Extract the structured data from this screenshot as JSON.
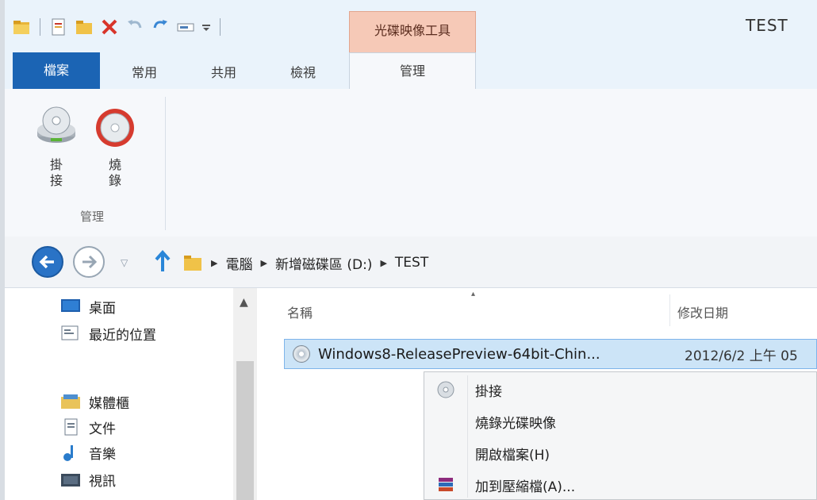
{
  "window": {
    "title": "TEST",
    "context_tab_title": "光碟映像工具"
  },
  "quick_access": {
    "icons": [
      "folder-icon",
      "properties-icon",
      "new-folder-icon",
      "delete-icon",
      "undo-icon",
      "redo-icon",
      "rename-icon",
      "customize-dropdown-icon"
    ]
  },
  "tabs": [
    {
      "label": "檔案"
    },
    {
      "label": "常用"
    },
    {
      "label": "共用"
    },
    {
      "label": "檢視"
    },
    {
      "label": "管理"
    }
  ],
  "ribbon": {
    "mount_label": "掛\n接",
    "burn_label": "燒\n錄",
    "group_label": "管理"
  },
  "address": {
    "breadcrumb": [
      "電腦",
      "新增磁碟區 (D:)",
      "TEST"
    ]
  },
  "nav_pane": {
    "items": [
      {
        "label": "桌面",
        "icon": "desktop-icon"
      },
      {
        "label": "最近的位置",
        "icon": "recent-places-icon"
      },
      {
        "label": "媒體櫃",
        "icon": "libraries-icon"
      },
      {
        "label": "文件",
        "icon": "documents-icon"
      },
      {
        "label": "音樂",
        "icon": "music-icon"
      },
      {
        "label": "視訊",
        "icon": "videos-icon"
      }
    ]
  },
  "file_list": {
    "columns": [
      "名稱",
      "修改日期"
    ],
    "rows": [
      {
        "name": "Windows8-ReleasePreview-64bit-Chin...",
        "date": "2012/6/2 上午 05"
      }
    ]
  },
  "context_menu": {
    "items": [
      {
        "label": "掛接",
        "icon": "disc-icon"
      },
      {
        "label": "燒錄光碟映像",
        "icon": ""
      },
      {
        "label": "開啟檔案(H)",
        "icon": ""
      },
      {
        "label": "加到壓縮檔(A)...",
        "icon": "winrar-icon"
      }
    ]
  },
  "colors": {
    "file_tab": "#1b64b4",
    "context_tab": "#f6c9b7",
    "selection": "#cce4f7",
    "back_button": "#2a73c6"
  }
}
